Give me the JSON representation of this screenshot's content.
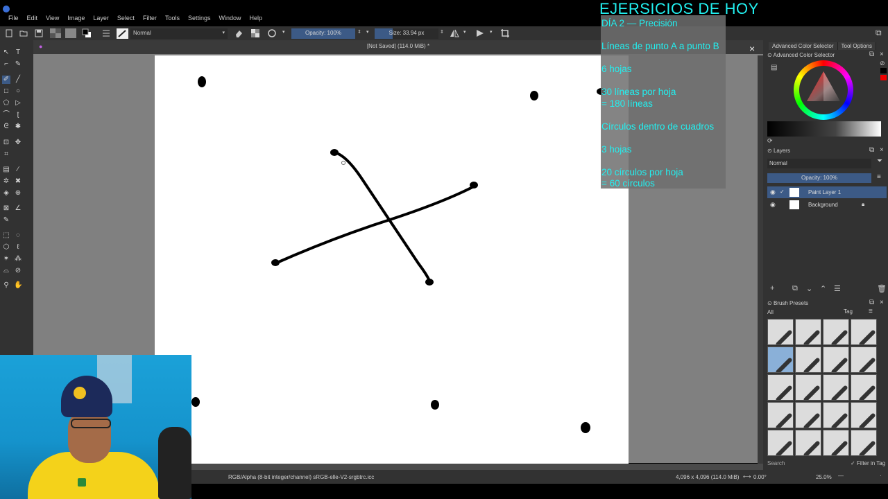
{
  "menu": {
    "items": [
      "File",
      "Edit",
      "View",
      "Image",
      "Layer",
      "Select",
      "Filter",
      "Tools",
      "Settings",
      "Window",
      "Help"
    ]
  },
  "toolbar": {
    "blend_mode": "Normal",
    "opacity_label": "Opacity: 100%",
    "size_label": "Size: 33.94 px"
  },
  "document": {
    "title": "[Not Saved]  (114.0 MiB) *"
  },
  "overlay": {
    "title": "EJERSICIOS DE HOY",
    "lines": [
      "DÍA 2 — Precisión",
      "Líneas de punto A a punto B",
      "6 hojas",
      "30 líneas por hoja",
      "= 180 líneas",
      "Círculos dentro de cuadros",
      "3 hojas",
      "20 círculos por hoja",
      "= 60 círculos"
    ]
  },
  "dockers": {
    "tabs": [
      "Advanced Color Selector",
      "Tool Options"
    ],
    "color_selector_title": "Advanced Color Selector",
    "layers_title": "Layers",
    "layers_blend": "Normal",
    "layers_opacity": "Opacity: 100%",
    "layers": [
      {
        "name": "Paint Layer 1",
        "selected": true
      },
      {
        "name": "Background",
        "selected": false
      }
    ],
    "brush_presets_title": "Brush Presets",
    "presets_filter": "All",
    "presets_tag": "Tag",
    "search_placeholder": "Search",
    "filter_in_tag": "Filter in Tag"
  },
  "status": {
    "color_info": "RGB/Alpha (8-bit integer/channel)  sRGB-elle-V2-srgbtrc.icc",
    "dimensions": "4,096 x 4,096 (114.0 MiB)",
    "rotation": "0.00°",
    "zoom": "25.0%"
  },
  "colors": {
    "accent": "#3c5a86",
    "overlay_text": "#22f0f0",
    "panel_bg": "#323232"
  }
}
